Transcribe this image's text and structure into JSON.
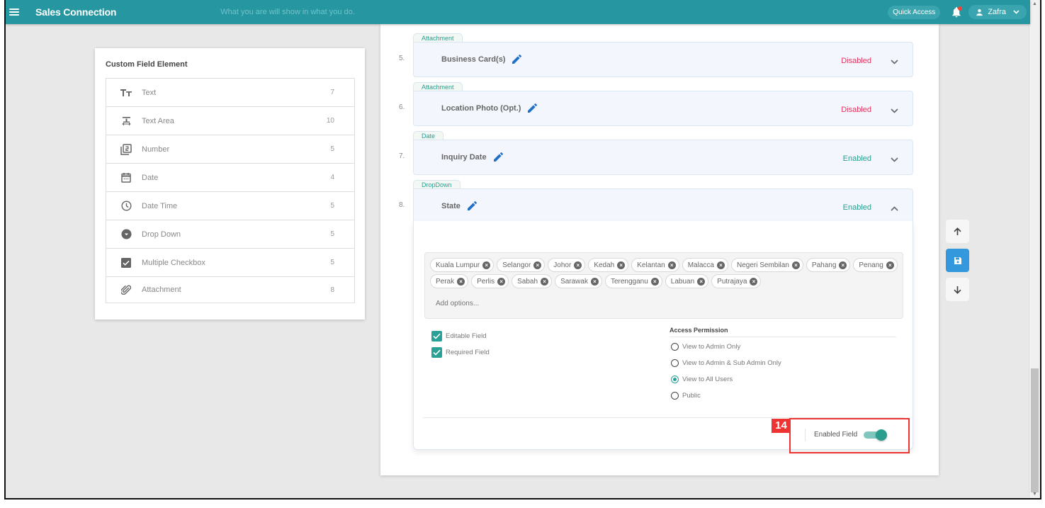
{
  "appbar": {
    "title": "Sales Connection",
    "tagline": "What you are will show in what you do.",
    "quick_access": "Quick Access",
    "user_name": "Zafra",
    "icons": {
      "menu": "hamburger-icon",
      "notifications": "bell-icon",
      "user": "person-icon",
      "dropdown": "chevron-down-icon"
    }
  },
  "left_panel": {
    "title": "Custom Field Element",
    "items": [
      {
        "label": "Text",
        "count": "7",
        "icon": "text-format-icon"
      },
      {
        "label": "Text Area",
        "count": "10",
        "icon": "text-area-icon"
      },
      {
        "label": "Number",
        "count": "5",
        "icon": "number-icon"
      },
      {
        "label": "Date",
        "count": "4",
        "icon": "calendar-icon"
      },
      {
        "label": "Date Time",
        "count": "5",
        "icon": "clock-icon"
      },
      {
        "label": "Drop Down",
        "count": "5",
        "icon": "dropdown-circle-icon"
      },
      {
        "label": "Multiple Checkbox",
        "count": "5",
        "icon": "checkbox-icon"
      },
      {
        "label": "Attachment",
        "count": "8",
        "icon": "paperclip-icon"
      }
    ]
  },
  "fields": [
    {
      "index": "5.",
      "type": "Attachment",
      "name": "Business Card(s)",
      "status": "Disabled",
      "expanded": false
    },
    {
      "index": "6.",
      "type": "Attachment",
      "name": "Location Photo (Opt.)",
      "status": "Disabled",
      "expanded": false
    },
    {
      "index": "7.",
      "type": "Date",
      "name": "Inquiry Date",
      "status": "Enabled",
      "expanded": false
    },
    {
      "index": "8.",
      "type": "DropDown",
      "name": "State",
      "status": "Enabled",
      "expanded": true
    }
  ],
  "expanded_field": {
    "options": [
      "Kuala Lumpur",
      "Selangor",
      "Johor",
      "Kedah",
      "Kelantan",
      "Malacca",
      "Negeri Sembilan",
      "Pahang",
      "Penang",
      "Perak",
      "Perlis",
      "Sabah",
      "Sarawak",
      "Terengganu",
      "Labuan",
      "Putrajaya"
    ],
    "add_options_placeholder": "Add options...",
    "checkboxes": [
      {
        "label": "Editable Field",
        "checked": true
      },
      {
        "label": "Required Field",
        "checked": true
      }
    ],
    "access_permission": {
      "title": "Access Permission",
      "options": [
        {
          "label": "View to Admin Only",
          "selected": false
        },
        {
          "label": "View to Admin & Sub Admin Only",
          "selected": false
        },
        {
          "label": "View to All Users",
          "selected": true
        },
        {
          "label": "Public",
          "selected": false
        }
      ]
    },
    "enabled_field": {
      "label": "Enabled Field",
      "on": true
    }
  },
  "annotation": {
    "number": "14"
  },
  "side_tools": [
    {
      "name": "move-up",
      "icon": "arrow-up-icon"
    },
    {
      "name": "save",
      "icon": "floppy-disk-icon"
    },
    {
      "name": "move-down",
      "icon": "arrow-down-icon"
    }
  ],
  "colors": {
    "brand": "#2697a1",
    "enabled": "#2a9d8f",
    "disabled": "#e0325c",
    "save_button": "#3398dc",
    "annotation": "#ee3333"
  }
}
